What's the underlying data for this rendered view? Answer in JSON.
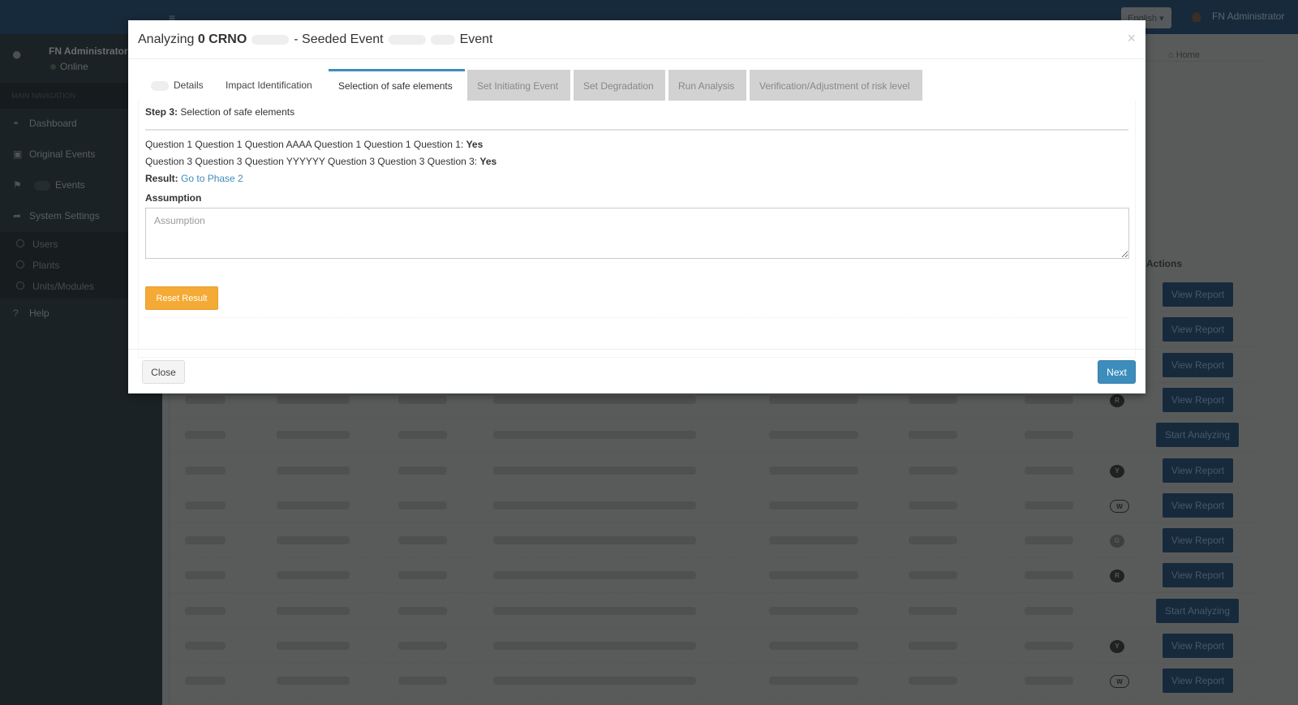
{
  "topbar": {
    "menu_icon": "hamburger-icon",
    "language": "English ▾",
    "user": "FN Administrator"
  },
  "sidebar": {
    "user_name": "FN Administrator",
    "status": "Online",
    "section": "MAIN NAVIGATION",
    "items": [
      {
        "label": "Dashboard",
        "icon": "dashboard-icon"
      },
      {
        "label": "Original Events",
        "icon": "inbox-icon"
      },
      {
        "label": "Events",
        "icon": "flag-icon"
      },
      {
        "label": "System Settings",
        "icon": "share-icon"
      }
    ],
    "subitems": [
      "Users",
      "Plants",
      "Units/Modules"
    ],
    "help": "Help"
  },
  "content": {
    "breadcrumb": "Home",
    "actions_header": "Actions",
    "rows": [
      {
        "badge": "",
        "action": "View Report"
      },
      {
        "badge": "",
        "action": "View Report"
      },
      {
        "badge": "",
        "action": "View Report"
      },
      {
        "badge": "R",
        "action": "View Report"
      },
      {
        "badge": "",
        "action": "Start Analyzing"
      },
      {
        "badge": "Y",
        "action": "View Report"
      },
      {
        "badge": "W",
        "action": "View Report"
      },
      {
        "badge": "G",
        "action": "View Report"
      },
      {
        "badge": "R",
        "action": "View Report"
      },
      {
        "badge": "",
        "action": "Start Analyzing"
      },
      {
        "badge": "Y",
        "action": "View Report"
      },
      {
        "badge": "W",
        "action": "View Report"
      }
    ]
  },
  "modal": {
    "title_prefix": "Analyzing",
    "title_code": "0 CRNO",
    "title_mid": "- Seeded Event",
    "title_suffix": "Event",
    "tabs": [
      {
        "label": "Details",
        "state": "normal"
      },
      {
        "label": "Impact Identification",
        "state": "normal"
      },
      {
        "label": "Selection of safe elements",
        "state": "active"
      },
      {
        "label": "Set Initiating Event",
        "state": "disabled"
      },
      {
        "label": "Set Degradation",
        "state": "disabled"
      },
      {
        "label": "Run Analysis",
        "state": "disabled"
      },
      {
        "label": "Verification/Adjustment of risk level",
        "state": "disabled"
      }
    ],
    "step_label": "Step 3:",
    "step_text": "Selection of safe elements",
    "q1_text": "Question 1 Question 1 Question AAAA Question 1 Question 1 Question 1:",
    "q1_answer": "Yes",
    "q3_text": "Question 3 Question 3 Question YYYYYY Question 3 Question 3 Question 3:",
    "q3_answer": "Yes",
    "result_label": "Result:",
    "result_link": "Go to Phase 2",
    "assumption_label": "Assumption",
    "assumption_placeholder": "Assumption",
    "assumption_value": "",
    "reset_button": "Reset Result",
    "close_button": "Close",
    "next_button": "Next",
    "close_icon": "×"
  },
  "colors": {
    "accent": "#3c8dbc",
    "warning": "#f39c12",
    "navy": "#172a3b"
  }
}
